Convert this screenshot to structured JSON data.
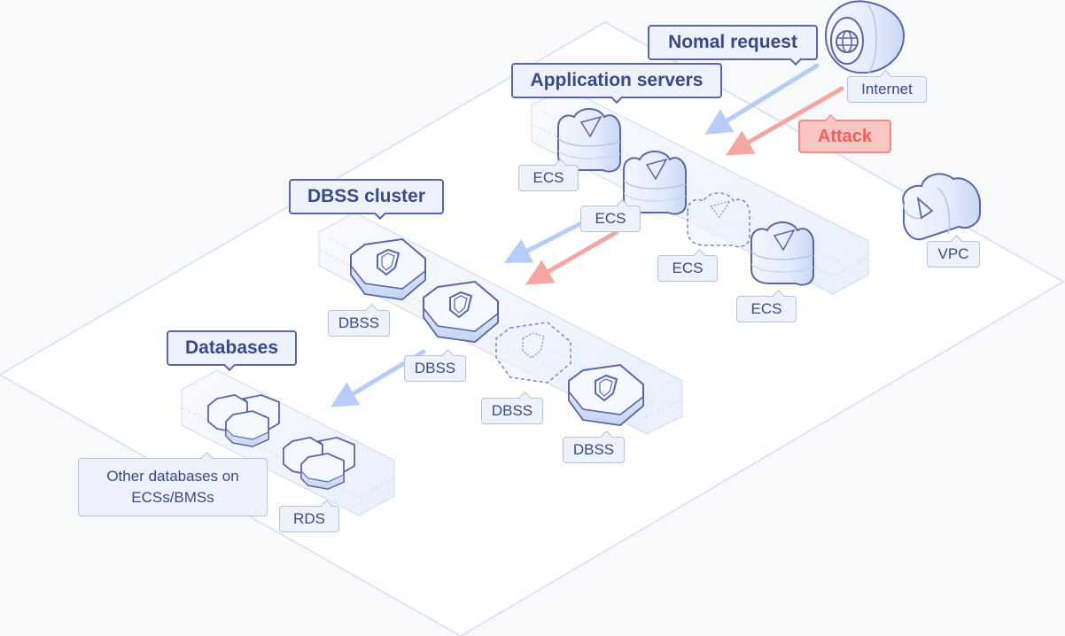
{
  "diagram": {
    "groups": {
      "app_servers": "Application servers",
      "dbss_cluster": "DBSS cluster",
      "databases": "Databases"
    },
    "flows": {
      "normal_request": "Nomal request",
      "attack": "Attack"
    },
    "nodes": {
      "internet": "Internet",
      "vpc": "VPC",
      "ecs": [
        "ECS",
        "ECS",
        "ECS",
        "ECS"
      ],
      "dbss": [
        "DBSS",
        "DBSS",
        "DBSS",
        "DBSS"
      ],
      "other_databases": "Other databases on ECSs/BMSs",
      "rds": "RDS"
    },
    "colors": {
      "outline": "#5a67a6",
      "label_bg": "#eef2fd",
      "label_text": "#3a4a86",
      "normal_flow": "#b7cdf7",
      "attack_flow": "#f6a6a2",
      "attack_label_bg": "#fbc5c3",
      "attack_label_text": "#f0605c",
      "platform_line": "#d6def3"
    }
  }
}
